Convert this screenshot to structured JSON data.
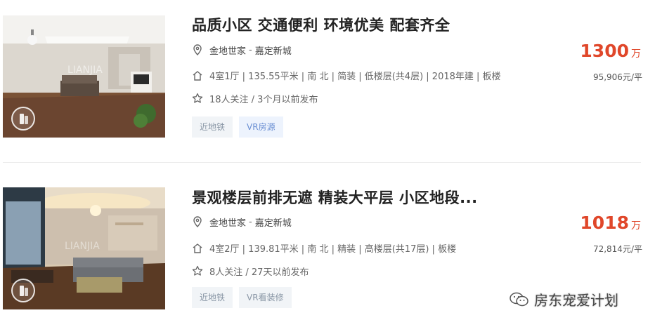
{
  "listings": [
    {
      "title": "品质小区 交通便利 环境优美 配套齐全",
      "community": "金地世家",
      "area": "嘉定新城",
      "separator": "-",
      "info": "4室1厅 | 135.55平米 | 南 北 | 简装 | 低楼层(共4层) | 2018年建 | 板楼",
      "follow": "18人关注 / 3个月以前发布",
      "tags": [
        "近地铁",
        "VR房源"
      ],
      "price": "1300",
      "price_unit": "万",
      "unit_price": "95,906元/平"
    },
    {
      "title": "景观楼层前排无遮 精装大平层 小区地段...",
      "community": "金地世家",
      "area": "嘉定新城",
      "separator": "-",
      "info": "4室2厅 | 139.81平米 | 南 北 | 精装 | 高楼层(共17层) | 板楼",
      "follow": "8人关注 / 27天以前发布",
      "tags": [
        "近地铁",
        "VR看装修"
      ],
      "price": "1018",
      "price_unit": "万",
      "unit_price": "72,814元/平"
    }
  ],
  "watermark": {
    "text": "房东宠爱计划",
    "icon": "wechat-icon"
  },
  "colors": {
    "price": "#e0472a",
    "tag_bg": "#f1f4f7",
    "vr_tag_text": "#6a8fd3"
  }
}
